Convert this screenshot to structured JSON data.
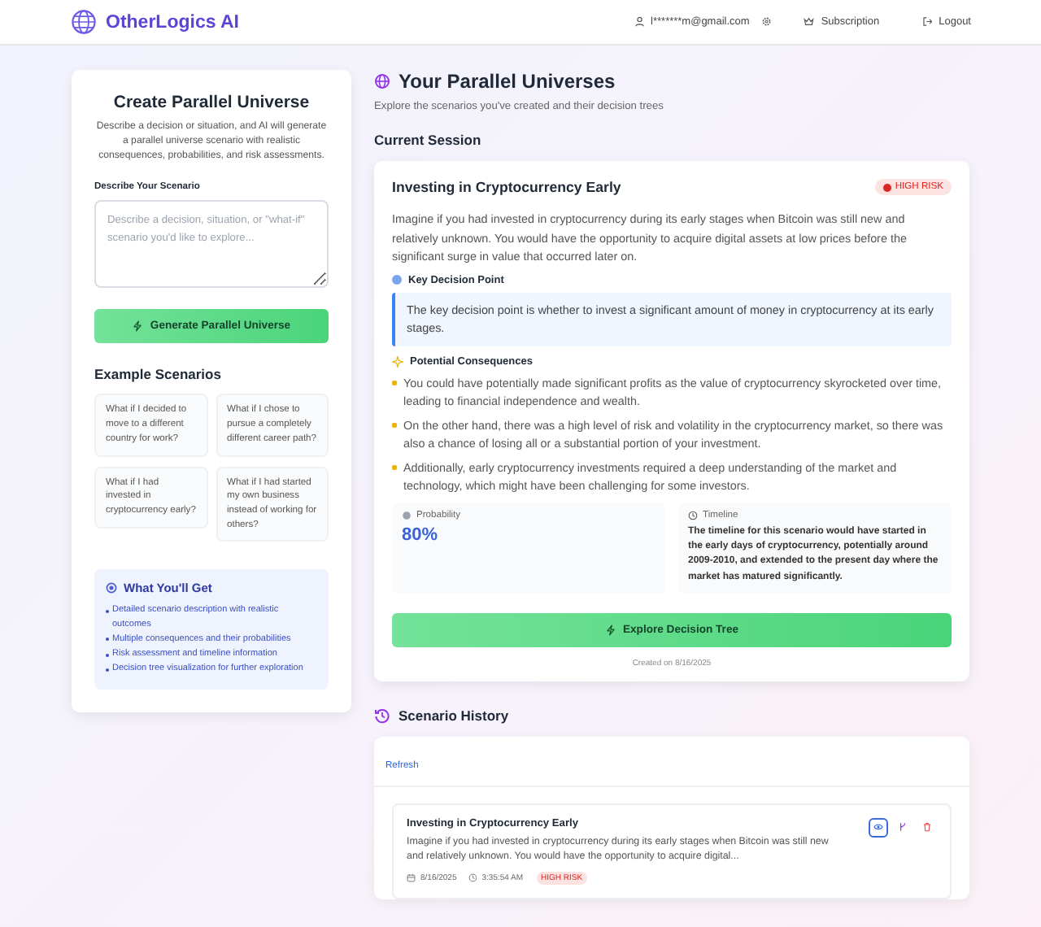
{
  "header": {
    "brand": "OtherLogics AI",
    "user_email": "l*******m@gmail.com",
    "links": [
      {
        "label": "Subscription",
        "kind": "subscription"
      },
      {
        "label": "Logout",
        "kind": "logout"
      }
    ]
  },
  "create_panel": {
    "title": "Create Parallel Universe",
    "description": "Describe a decision or situation, and AI will generate a parallel universe scenario with realistic consequences, probabilities, and risk assessments.",
    "field_label": "Describe Your Scenario",
    "placeholder": "Describe a decision, situation, or \"what-if\" scenario you'd like to explore...",
    "generate_button": "Generate Parallel Universe",
    "examples_title": "Example Scenarios",
    "examples": [
      "What if I decided to move to a different country for work?",
      "What if I chose to pursue a completely different career path?",
      "What if I had invested in cryptocurrency early?",
      "What if I had started my own business instead of working for others?"
    ],
    "benefits_title": "What You'll Get",
    "benefits": [
      "Detailed scenario description with realistic outcomes",
      "Multiple consequences and their probabilities",
      "Risk assessment and timeline information",
      "Decision tree visualization for further exploration"
    ]
  },
  "universes": {
    "title": "Your Parallel Universes",
    "subtitle": "Explore the scenarios you've created and their decision trees",
    "session_title": "Current Session",
    "current": {
      "title": "Investing in Cryptocurrency Early",
      "risk_label": "HIGH RISK",
      "description": "Imagine if you had invested in cryptocurrency during its early stages when Bitcoin was still new and relatively unknown. You would have the opportunity to acquire digital assets at low prices before the significant surge in value that occurred later on.",
      "decision_title": "Key Decision Point",
      "decision": "The key decision point is whether to invest a significant amount of money in cryptocurrency at its early stages.",
      "consequences_title": "Potential Consequences",
      "consequences": [
        "You could have potentially made significant profits as the value of cryptocurrency skyrocketed over time, leading to financial independence and wealth.",
        "On the other hand, there was a high level of risk and volatility in the cryptocurrency market, so there was also a chance of losing all or a substantial portion of your investment.",
        "Additionally, early cryptocurrency investments required a deep understanding of the market and technology, which might have been challenging for some investors."
      ],
      "probability_label": "Probability",
      "probability": "80%",
      "timeline_label": "Timeline",
      "timeline": "The timeline for this scenario would have started in the early days of cryptocurrency, potentially around 2009-2010, and extended to the present day where the market has matured significantly.",
      "explore_button": "Explore Decision Tree",
      "created": "Created on 8/16/2025"
    },
    "history_title": "Scenario History",
    "refresh": "Refresh",
    "history": [
      {
        "title": "Investing in Cryptocurrency Early",
        "description": "Imagine if you had invested in cryptocurrency during its early stages when Bitcoin was still new and relatively unknown. You would have the opportunity to acquire digital...",
        "date": "8/16/2025",
        "time": "3:35:54 AM",
        "risk_label": "HIGH RISK"
      }
    ]
  }
}
